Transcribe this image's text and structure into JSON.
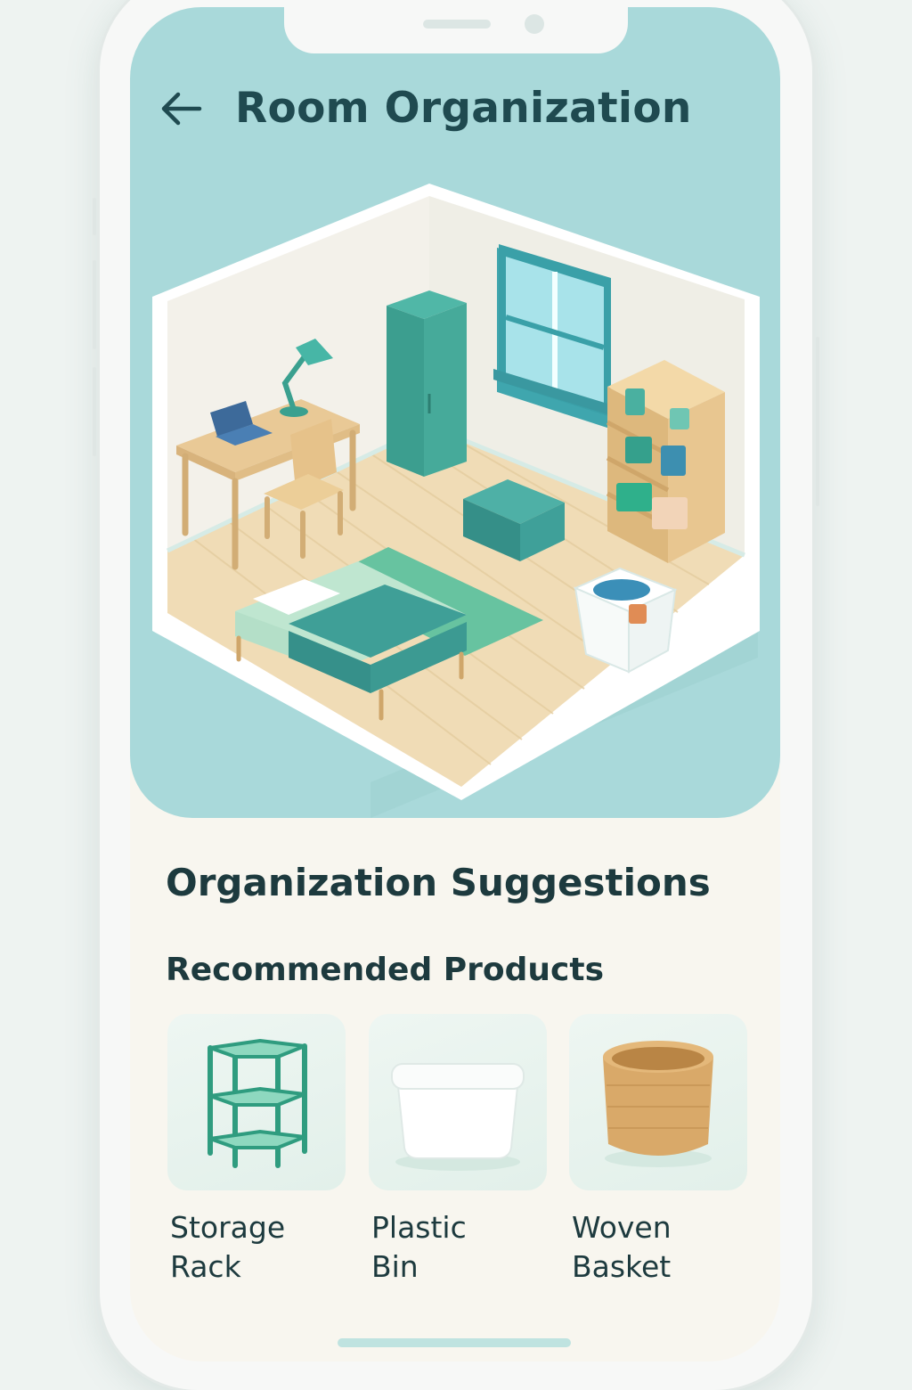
{
  "header": {
    "title": "Room Organization",
    "back_icon": "arrow-left-icon"
  },
  "hero": {
    "illustration": "isometric-bedroom-illustration",
    "background_color": "#a9d9da"
  },
  "suggestions": {
    "title": "Organization Suggestions",
    "subtitle": "Recommended Products",
    "products": [
      {
        "label": "Storage\nRack",
        "icon": "storage-rack-icon"
      },
      {
        "label": "Plastic\nBin",
        "icon": "plastic-bin-icon"
      },
      {
        "label": "Woven\nBasket",
        "icon": "woven-basket-icon"
      }
    ]
  },
  "colors": {
    "accent": "#3aa58f",
    "title_text": "#1f4a50",
    "body_text": "#1d3a3e",
    "card_bg": "#e6f2ed"
  }
}
